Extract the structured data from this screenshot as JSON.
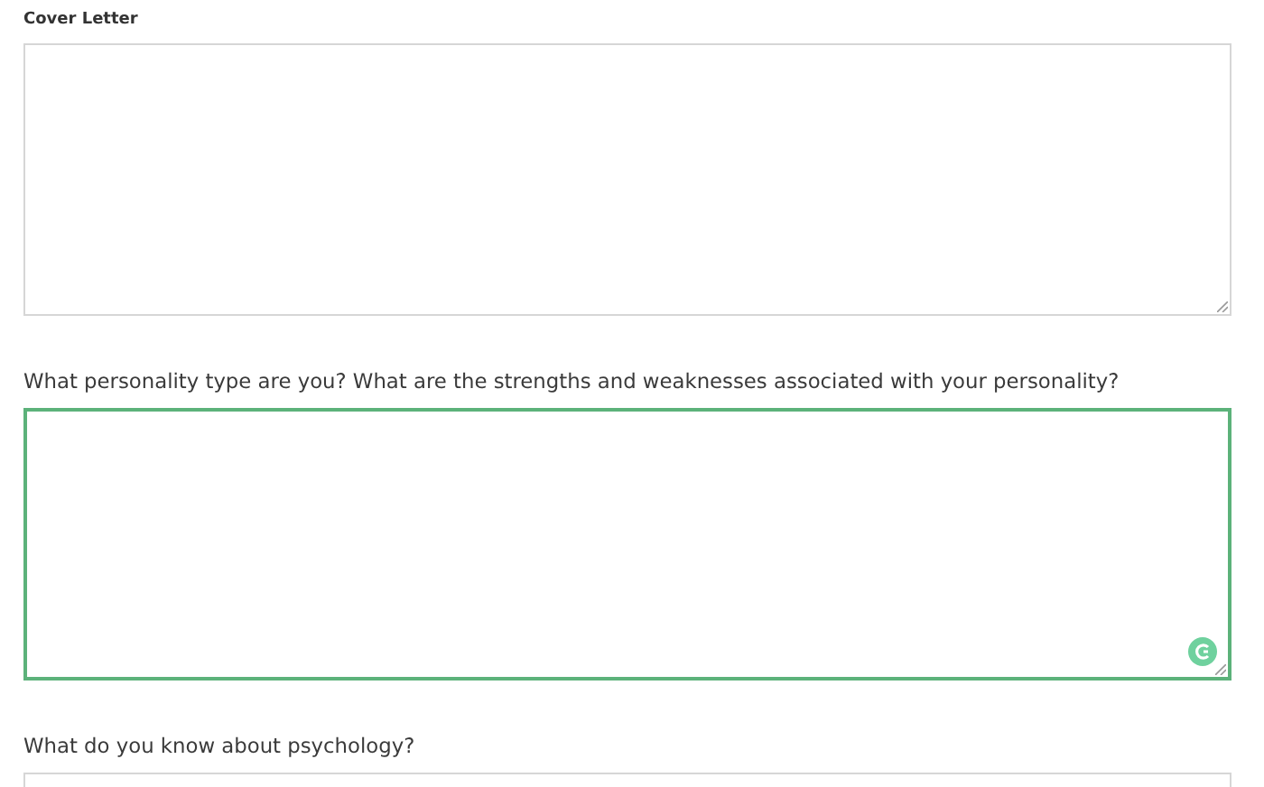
{
  "fields": [
    {
      "label": "Cover Letter",
      "kind": "heading",
      "focused": false
    },
    {
      "label": "What personality type are you? What are the strengths and weaknesses associated with your personality?",
      "kind": "question",
      "focused": true
    },
    {
      "label": "What do you know about psychology?",
      "kind": "question",
      "focused": false
    }
  ]
}
